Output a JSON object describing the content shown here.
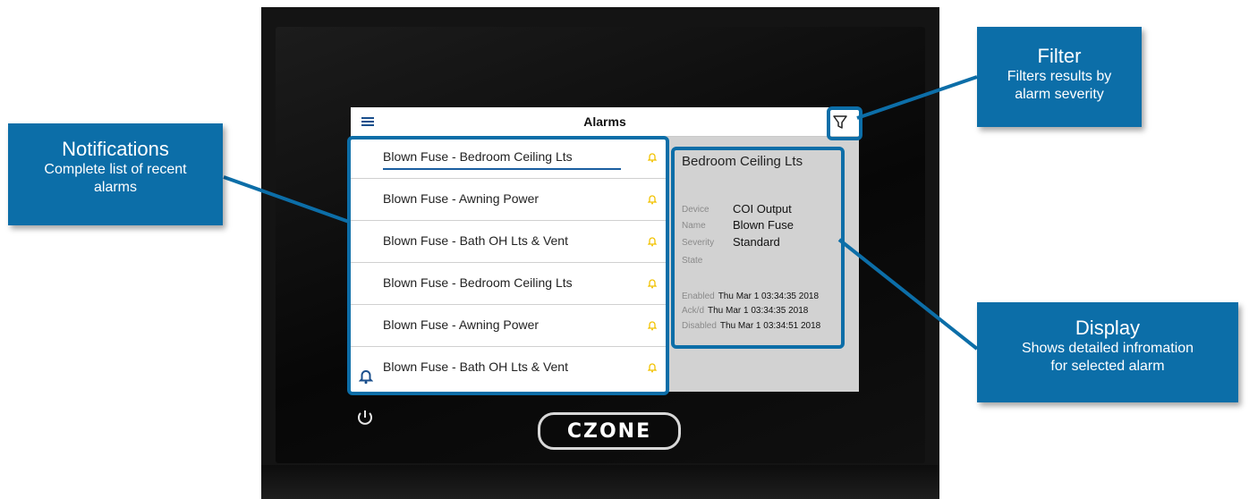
{
  "screen": {
    "title": "Alarms",
    "alarms": [
      {
        "label": "Blown Fuse - Bedroom Ceiling Lts",
        "selected": true
      },
      {
        "label": "Blown Fuse - Awning Power"
      },
      {
        "label": "Blown Fuse - Bath OH Lts & Vent"
      },
      {
        "label": "Blown Fuse - Bedroom Ceiling Lts"
      },
      {
        "label": "Blown Fuse - Awning Power"
      },
      {
        "label": "Blown Fuse - Bath OH Lts & Vent"
      }
    ],
    "detail": {
      "heading": "Bedroom Ceiling Lts",
      "device_label": "Device",
      "device_value": "COI Output",
      "name_label": "Name",
      "name_value": "Blown Fuse",
      "severity_label": "Severity",
      "severity_value": "Standard",
      "state_label": "State",
      "enabled_label": "Enabled",
      "enabled_value": "Thu Mar 1 03:34:35 2018",
      "ackd_label": "Ack/d",
      "ackd_value": "Thu Mar 1 03:34:35 2018",
      "disabled_label": "Disabled",
      "disabled_value": "Thu Mar 1 03:34:51 2018"
    }
  },
  "brand": "CZONE",
  "callouts": {
    "notifications": {
      "title": "Notifications",
      "desc1": "Complete list of recent",
      "desc2": "alarms"
    },
    "filter": {
      "title": "Filter",
      "desc1": "Filters results by",
      "desc2": "alarm severity"
    },
    "display": {
      "title": "Display",
      "desc1": "Shows detailed infromation",
      "desc2": "for selected alarm"
    }
  },
  "colors": {
    "accent": "#0c6ea8",
    "bell": "#f2c200",
    "selection_line": "#1a5ea0"
  }
}
